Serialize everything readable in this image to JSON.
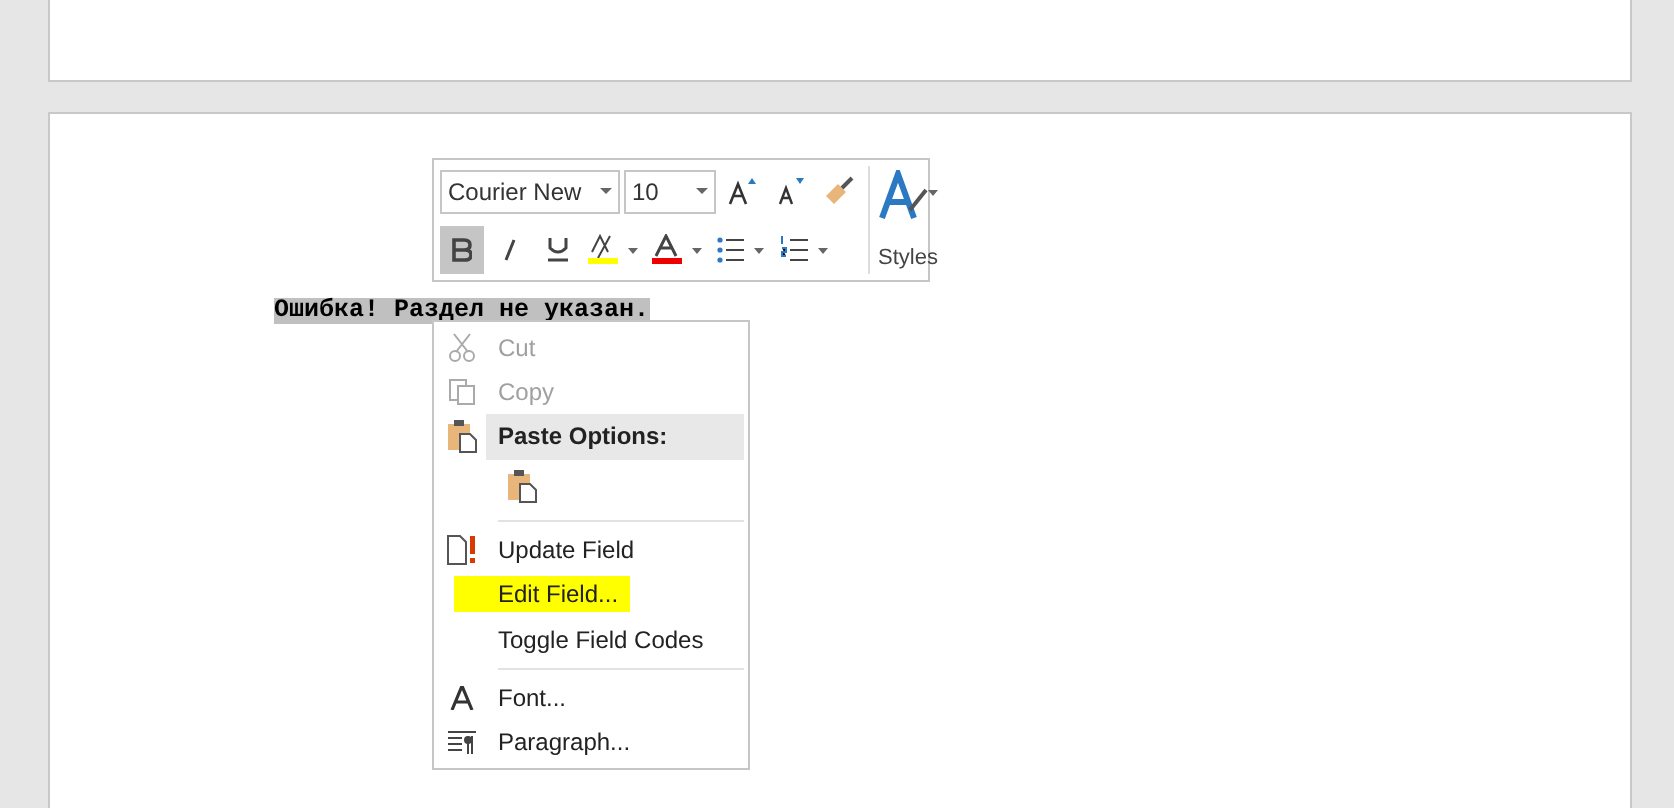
{
  "document": {
    "text": "Ошибка! Раздел не указан.",
    "selected": true
  },
  "mini_toolbar": {
    "font": "Courier New",
    "size": "10",
    "bold": true,
    "styles_label": "Styles"
  },
  "context_menu": {
    "items": [
      {
        "kind": "item",
        "label": "Cut",
        "disabled": true,
        "highlighted": false
      },
      {
        "kind": "item",
        "label": "Copy",
        "disabled": true,
        "highlighted": false
      },
      {
        "kind": "header",
        "label": "Paste Options:"
      },
      {
        "kind": "paste"
      },
      {
        "kind": "separator"
      },
      {
        "kind": "item",
        "label": "Update Field",
        "disabled": false,
        "highlighted": false
      },
      {
        "kind": "item",
        "label": "Edit Field...",
        "disabled": false,
        "highlighted": true
      },
      {
        "kind": "item",
        "label": "Toggle Field Codes",
        "disabled": false,
        "highlighted": false
      },
      {
        "kind": "separator"
      },
      {
        "kind": "item",
        "label": "Font...",
        "disabled": false,
        "highlighted": false
      },
      {
        "kind": "item",
        "label": "Paragraph...",
        "disabled": false,
        "highlighted": false
      }
    ]
  }
}
